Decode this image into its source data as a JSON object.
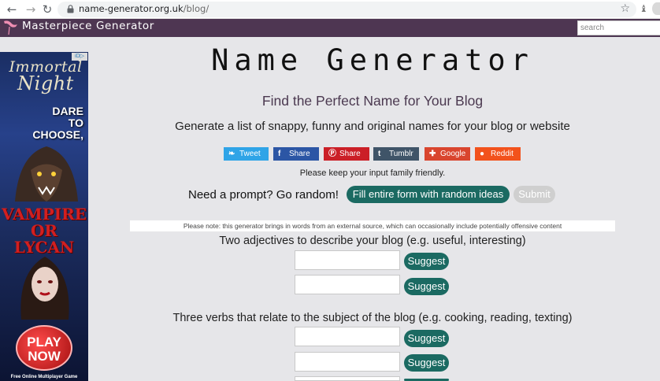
{
  "browser": {
    "url_domain": "name-generator.org.uk",
    "url_path": "/blog/"
  },
  "site": {
    "name": "Masterpiece Generator",
    "search_placeholder": "search"
  },
  "ad": {
    "adchoice": "iD▷",
    "title_line1": "Immortal",
    "title_line2": "Night",
    "dare": "DARE",
    "to": "TO",
    "choose": "CHOOSE,",
    "vampire": "VAMPIRE",
    "or_lycan": "OR LYCAN",
    "play": "PLAY",
    "now": "NOW",
    "footer": "Free Online Multiplayer Game"
  },
  "page": {
    "title": "Name Generator",
    "subtitle": "Find the Perfect Name for Your Blog",
    "description": "Generate a list of snappy, funny and original names for your blog or website",
    "friendly_note": "Please keep your input family friendly.",
    "prompt_text": "Need a prompt? Go random!",
    "random_button": "Fill entire form with random ideas",
    "submit_button": "Submit",
    "offensive_note": "Please note: this generator brings in words from an external source, which can occasionally include potentially offensive content"
  },
  "share": [
    {
      "label": "Tweet",
      "icon": "twitter-icon",
      "glyph": "❧",
      "color": "#2fa4e7"
    },
    {
      "label": "Share",
      "icon": "facebook-icon",
      "glyph": "f",
      "color": "#2c56a5"
    },
    {
      "label": "Share",
      "icon": "pinterest-icon",
      "glyph": "Ⓟ",
      "color": "#cb1f27"
    },
    {
      "label": "Tumblr",
      "icon": "tumblr-icon",
      "glyph": "t",
      "color": "#3f5468"
    },
    {
      "label": "Google",
      "icon": "google-plus-icon",
      "glyph": "✚",
      "color": "#d9452e"
    },
    {
      "label": "Reddit",
      "icon": "reddit-icon",
      "glyph": "●",
      "color": "#f2521c"
    }
  ],
  "form": {
    "q1_label": "Two adjectives to describe your blog (e.g. useful, interesting)",
    "q2_label": "Three verbs that relate to the subject of the blog (e.g. cooking, reading, texting)",
    "suggest_label": "Suggest"
  }
}
